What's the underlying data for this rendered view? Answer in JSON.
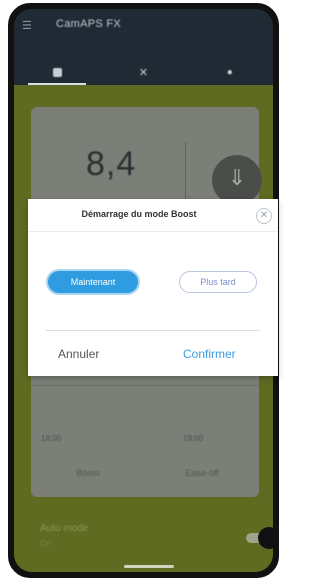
{
  "app": {
    "title": "CamAPS FX"
  },
  "tabs": [
    {
      "name": "home-tab",
      "icon": "home-icon"
    },
    {
      "name": "close-tab",
      "icon": "cross-icon"
    },
    {
      "name": "drop-tab",
      "icon": "drop-icon"
    }
  ],
  "card": {
    "value": "8,4",
    "tick_left": "18:00",
    "tick_right": "19:00",
    "buttons": [
      "Boost",
      "Ease-off"
    ]
  },
  "bottom": {
    "label": "Auto mode",
    "sub": "On"
  },
  "modal": {
    "title": "Démarrage du mode Boost",
    "option_now": "Maintenant",
    "option_later": "Plus tard",
    "cancel": "Annuler",
    "confirm": "Confirmer"
  },
  "colors": {
    "appbar": "#1f2a35",
    "background": "#5e6b21",
    "primary": "#2f9be0",
    "confirm": "#3a9de0"
  }
}
